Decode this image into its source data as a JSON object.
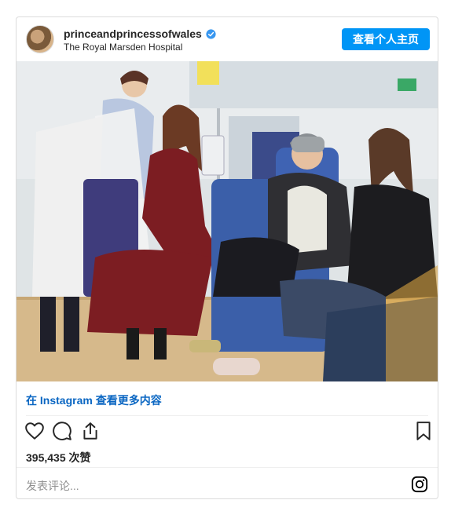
{
  "post": {
    "username": "princeandprincessofwales",
    "location": "The Royal Marsden Hospital",
    "profile_button": "查看个人主页",
    "view_more": "在 Instagram 查看更多内容",
    "likes": "395,435 次赞",
    "comment_placeholder": "发表评论..."
  },
  "icons": {
    "verified": "verified-badge-icon",
    "like": "heart-icon",
    "comment": "comment-bubble-icon",
    "share": "share-icon",
    "save": "bookmark-icon",
    "instagram": "instagram-logo-icon"
  },
  "colors": {
    "accent": "#0095f6",
    "link": "#00376b",
    "muted": "#8e8e8e"
  }
}
